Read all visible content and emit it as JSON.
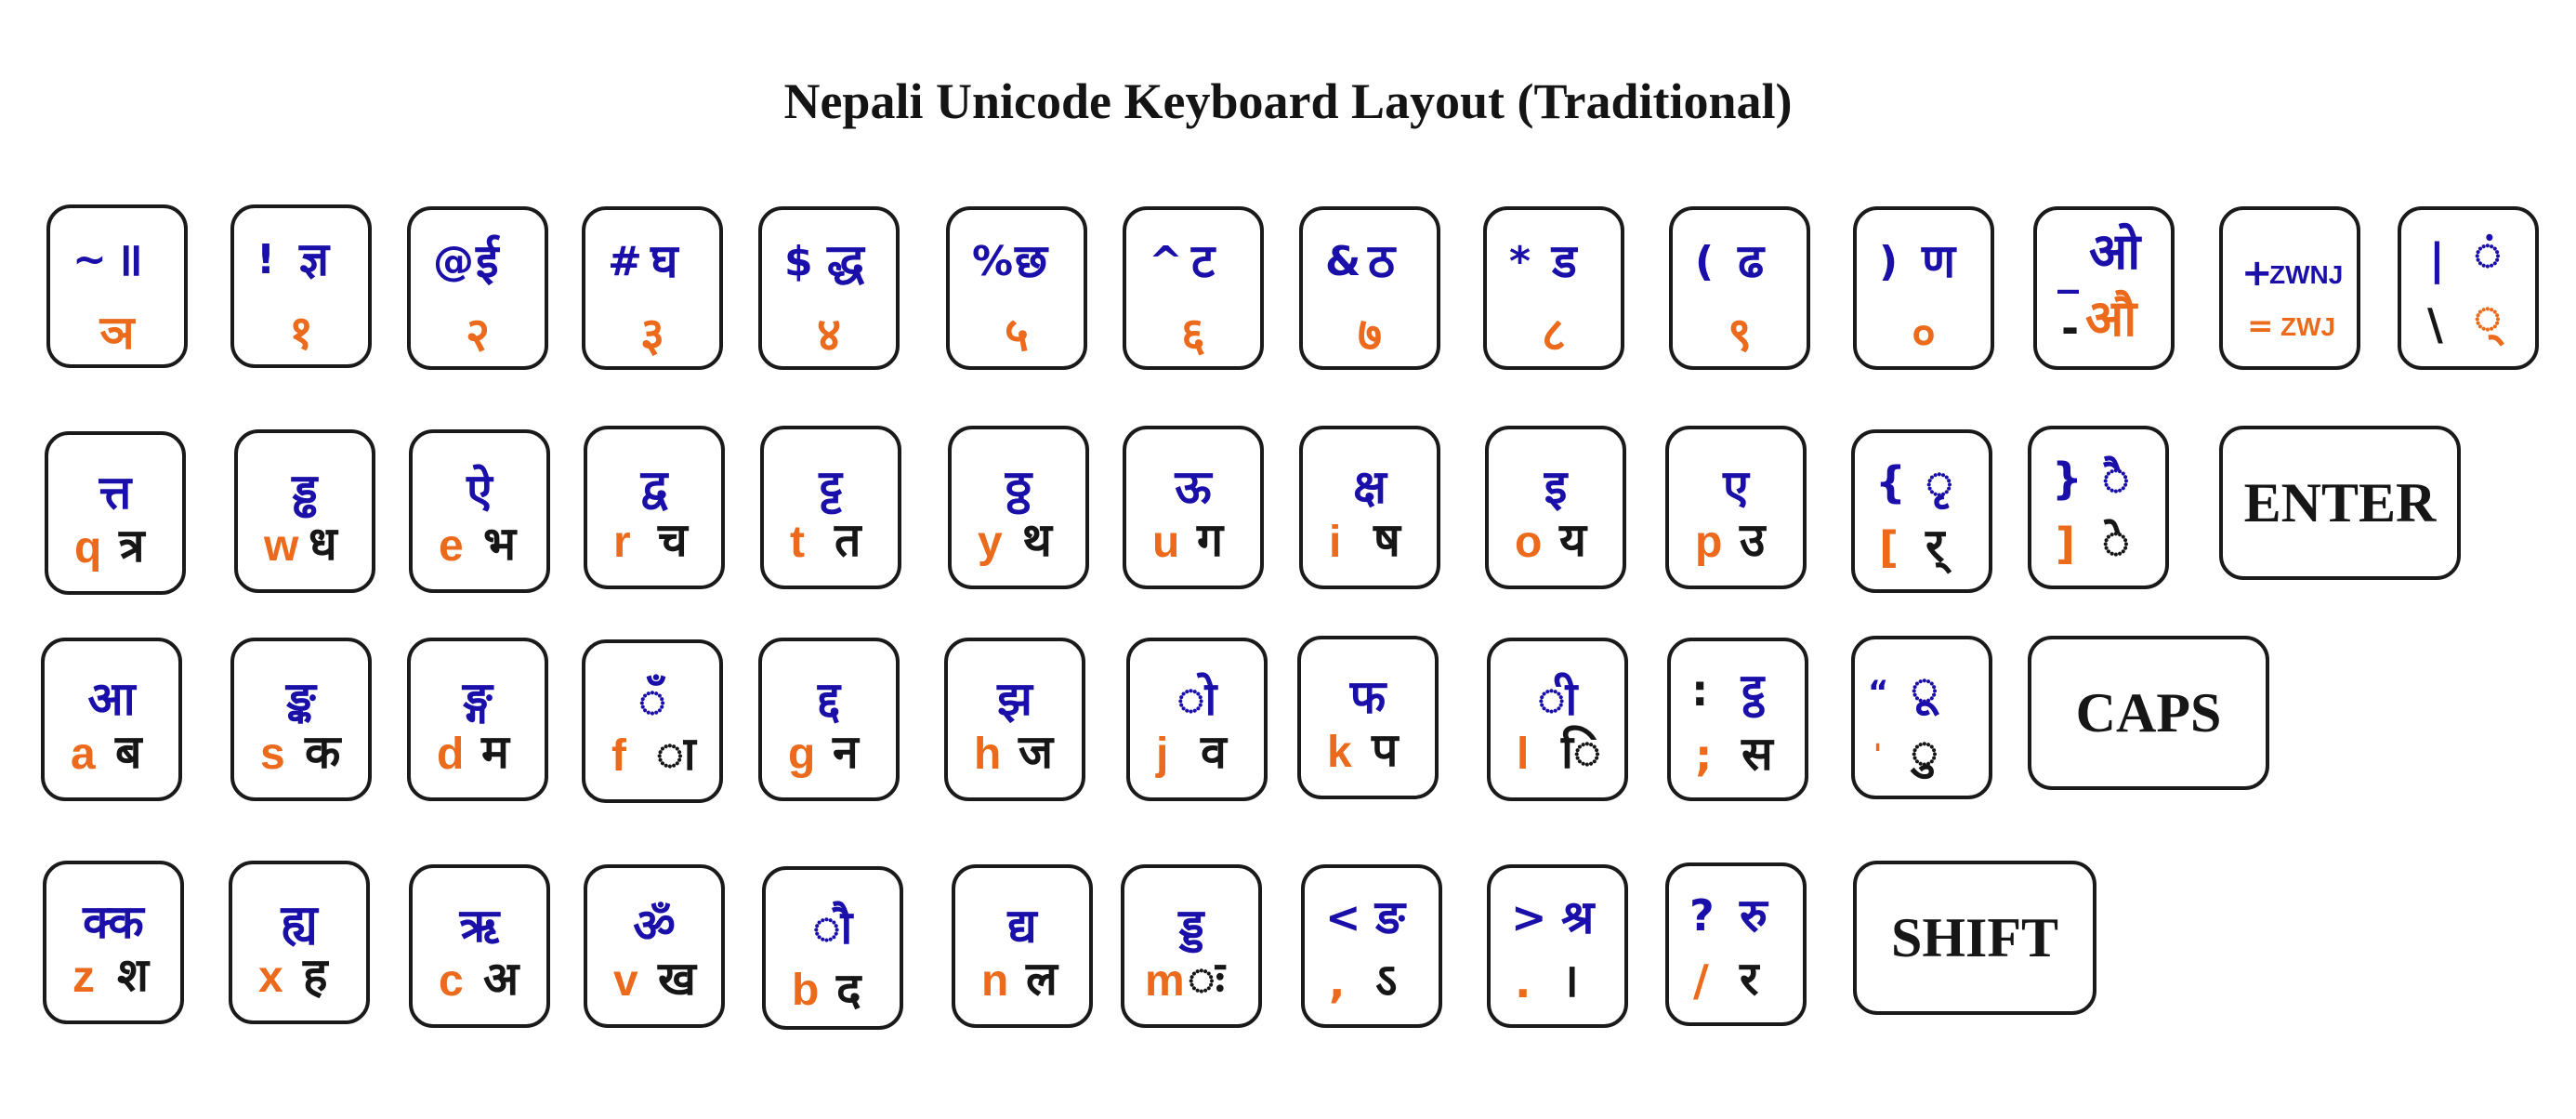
{
  "title": "Nepali Unicode Keyboard Layout (Traditional)",
  "colors": {
    "shift_layer": "#1a0fa8",
    "latin_or_digit": "#ec6a1c",
    "base_devanagari": "#161616",
    "key_border": "#1a1a1a"
  },
  "rows": {
    "number": [
      {
        "id": "backtick",
        "shift_symbol": "~",
        "shift_char": "॥",
        "base": "ञ"
      },
      {
        "id": "1",
        "shift_symbol": "!",
        "shift_char": "ज्ञ",
        "base": "१"
      },
      {
        "id": "2",
        "shift_symbol": "@",
        "shift_char": "ई",
        "base": "२"
      },
      {
        "id": "3",
        "shift_symbol": "#",
        "shift_char": "घ",
        "base": "३"
      },
      {
        "id": "4",
        "shift_symbol": "$",
        "shift_char": "द्ध",
        "base": "४"
      },
      {
        "id": "5",
        "shift_symbol": "%",
        "shift_char": "छ",
        "base": "५"
      },
      {
        "id": "6",
        "shift_symbol": "^",
        "shift_char": "ट",
        "base": "६"
      },
      {
        "id": "7",
        "shift_symbol": "&",
        "shift_char": "ठ",
        "base": "७"
      },
      {
        "id": "8",
        "shift_symbol": "*",
        "shift_char": "ड",
        "base": "८"
      },
      {
        "id": "9",
        "shift_symbol": "(",
        "shift_char": "ढ",
        "base": "९"
      },
      {
        "id": "0",
        "shift_symbol": ")",
        "shift_char": "ण",
        "base": "०"
      },
      {
        "id": "minus",
        "shift_symbol": "_",
        "shift_char": "ओ",
        "base_symbol": "-",
        "base": "औ"
      },
      {
        "id": "equals",
        "shift_symbol": "+",
        "shift_char": "ZWNJ",
        "base_symbol": "=",
        "base": "ZWJ"
      },
      {
        "id": "backslash",
        "shift_symbol": "|",
        "shift_char": "◌ं",
        "base_symbol": "\\",
        "base": "◌्"
      }
    ],
    "top": [
      {
        "latin": "q",
        "shift": "त्त",
        "base": "त्र"
      },
      {
        "latin": "w",
        "shift": "ड्ढ",
        "base": "ध"
      },
      {
        "latin": "e",
        "shift": "ऐ",
        "base": "भ"
      },
      {
        "latin": "r",
        "shift": "द्व",
        "base": "च"
      },
      {
        "latin": "t",
        "shift": "ट्ट",
        "base": "त"
      },
      {
        "latin": "y",
        "shift": "ठ्ठ",
        "base": "थ"
      },
      {
        "latin": "u",
        "shift": "ऊ",
        "base": "ग"
      },
      {
        "latin": "i",
        "shift": "क्ष",
        "base": "ष"
      },
      {
        "latin": "o",
        "shift": "इ",
        "base": "य"
      },
      {
        "latin": "p",
        "shift": "ए",
        "base": "उ"
      },
      {
        "latin": "[",
        "shift_symbol": "{",
        "shift": "◌ृ",
        "base": "र्"
      },
      {
        "latin": "]",
        "shift_symbol": "}",
        "shift": "◌ै",
        "base": "◌े"
      }
    ],
    "home": [
      {
        "latin": "a",
        "shift": "आ",
        "base": "ब"
      },
      {
        "latin": "s",
        "shift": "ङ्क",
        "base": "क"
      },
      {
        "latin": "d",
        "shift": "ङ्ग",
        "base": "म"
      },
      {
        "latin": "f",
        "shift": "◌ँ",
        "base": "◌ा"
      },
      {
        "latin": "g",
        "shift": "द्द",
        "base": "न"
      },
      {
        "latin": "h",
        "shift": "झ",
        "base": "ज"
      },
      {
        "latin": "j",
        "shift": "◌ो",
        "base": "व"
      },
      {
        "latin": "k",
        "shift": "फ",
        "base": "प"
      },
      {
        "latin": "l",
        "shift": "◌ी",
        "base": "◌ि"
      },
      {
        "latin": ";",
        "shift_symbol": ":",
        "shift": "ट्ठ",
        "base": "स"
      },
      {
        "latin": "'",
        "shift_symbol": "“",
        "shift": "◌ू",
        "base": "◌ु"
      }
    ],
    "bottom": [
      {
        "latin": "z",
        "shift": "क्क",
        "base": "श"
      },
      {
        "latin": "x",
        "shift": "ह्य",
        "base": "ह"
      },
      {
        "latin": "c",
        "shift": "ऋ",
        "base": "अ"
      },
      {
        "latin": "v",
        "shift": "ॐ",
        "base": "ख"
      },
      {
        "latin": "b",
        "shift": "◌ौ",
        "base": "द"
      },
      {
        "latin": "n",
        "shift": "द्य",
        "base": "ल"
      },
      {
        "latin": "m",
        "shift": "ड्ड",
        "base": "◌ः"
      },
      {
        "latin": ",",
        "shift_symbol": "<",
        "shift": "ङ",
        "base": "ऽ"
      },
      {
        "latin": ".",
        "shift_symbol": ">",
        "shift": "श्र",
        "base": "।"
      },
      {
        "latin": "/",
        "shift_symbol": "?",
        "shift": "रु",
        "base": "र"
      }
    ]
  },
  "special_keys": {
    "enter": "ENTER",
    "caps": "CAPS",
    "shift": "SHIFT"
  }
}
